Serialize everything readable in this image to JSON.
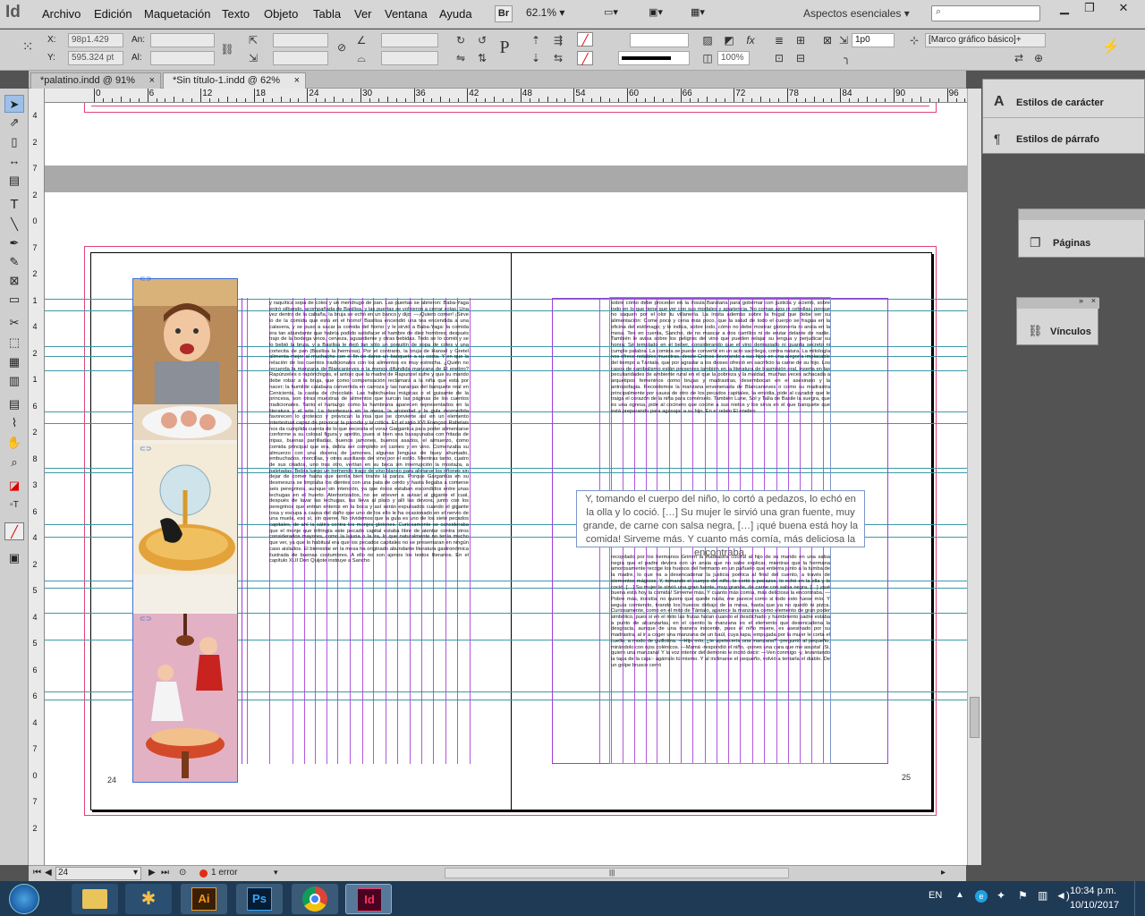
{
  "menubar": {
    "logo": "Id",
    "items": [
      "Archivo",
      "Edición",
      "Maquetación",
      "Texto",
      "Objeto",
      "Tabla",
      "Ver",
      "Ventana",
      "Ayuda"
    ],
    "bridge_label": "Br",
    "zoom": "62.1%",
    "workspace": "Aspectos esenciales",
    "search_placeholder": ""
  },
  "control": {
    "x_label": "X:",
    "x_value": "98p1.429",
    "y_label": "Y:",
    "y_value": "595.324 pt",
    "w_label": "An:",
    "h_label": "Al:",
    "stroke_weight": "1p0",
    "scale_percent": "100%",
    "object_style": "[Marco gráfico básico]+"
  },
  "tabs": [
    {
      "label": "*palatino.indd @ 91%"
    },
    {
      "label": "*Sin título-1.indd @ 62%"
    }
  ],
  "ruler": {
    "h_labels": [
      "0",
      "6",
      "12",
      "18",
      "24",
      "30",
      "36",
      "42",
      "48",
      "54",
      "60",
      "66",
      "72",
      "78",
      "84",
      "90",
      "96"
    ],
    "v_labels": [
      "4",
      "2",
      "7",
      "2",
      "0",
      "7",
      "2",
      "1",
      "4",
      "2",
      "1",
      "6",
      "2",
      "8",
      "3",
      "6",
      "4",
      "2",
      "5",
      "4",
      "5",
      "6",
      "6",
      "4",
      "7",
      "0",
      "7",
      "2"
    ]
  },
  "pages": {
    "left_number": "24",
    "right_number": "25",
    "pull_quote": "Y, tomando el cuerpo del niño, lo cortó a pedazos, lo echó en la olla y lo coció. […] Su mujer le sirvió una gran fuente, muy grande, de carne con salsa negra, […] ¡qué buena está hoy la comida! Sirveme más. Y cuanto más comía, más deliciosa la encontraba.",
    "left_text": "y raquítica sopa de coles y un mendrugo de pan. Las puertas se abrieron: Baba-Yaga entró silbando, acompañada de Basilisa, y las puertas se volvieron a cerrar solas. Una vez dentro de la cabaña, la bruja se echó en un banco y dijo: —¡Quiero comer! ¡Sirve lo de la comida que está en el horno! Basilisa encendió una tea encendida a una calavera, y se puso a sacar la comida del horno: y le sirvió a Baba-Yaga: la comida era tan abundante que habría podido satisfacer el hambre de diez hombres; después trajo de la bodega vinos, cerveza, aguardiente y otras bebidas. Todo se lo comió y se lo bebió la bruja, y a Basilisa le dejó tan sólo un poquitín de sopa de coles y una cortecita de pan (Basilisa la hermosa). Por el contrario, la bruja de Hansel y Gretel alimenta mejor al muchacho con el fin de darse un banquete a su costa. Y en que la relación de los cuentos tradicionales con los alimentos es muy estrecha. ¿Quién no recuerda la manzana de Blancanieves o la menos difundida manzana de El enebro? Rapúnzeles o rapónchigos, el antojo que la madre de Rapunzel sufre y que su marido debe robar a la bruja, que como compensación reclamará a la niña que está por nacer; la humilde calabaza convertida en carroza y las naranjas del banquete real en Cenicienta, la casita de chocolate. Las habichuelas mágicas o el guisante de la princesa, son otras muestras de alimentos que surcan las páginas de los cuentos tradicionales. Tanto el hartazgo como la hambruna aparecen representados en la literatura y el arte. La desmesura en la mesa, la ansiedad y la gula desmedida favorecen lo grotesco y provocan la risa que se convierte así en un elemento intertextual capaz de provocar la parodia y la crítica. En el siglo XVI François Rabelais nos da cumplida cuenta de lo que necesita el voraz Gargantúa para poder alimentarse conforme a su colosal figura y apetito, pues si bien sea basayunaba con fritada de tripas, buenas parrilladas, buenos jamones, buenos asados, el almuerzo, como comida principal que era, debía ser completo en carnes y en vino. Comenzaba su almuerzo con una docena de jamones, algunas lenguas de buey ahumado, embuchados, morcillas, y otros auxiliares del vino por el estilo. Mientras tanto, cuatro de sus criados, uno tras otro, vertían en su boca sin interrupción la mostaza, a paletadas. Bebía luego un tremendo trago de vino blanco para aliviarse los riñones sin dejar de comer hasta que sentía bien tirante la panza. Porque Gargantúa en su desmesura se limpiaba los dientes con una pata de cerdo y hasta llegaba a comerse seis peregrinos, aunque sin intención, ya que éstos estaban escondidos entre unas lechugas en el huerto. Atemorizados, no se atreven a avisar al gigante el cual, después de lavar las lechugas, las lleva al plato y allí las devora, junto con los peregrinos que entran enteros en la boca y así serán expulsados cuando el gigante tosa y escupa a causa del daño que uno de los ello le ha ocasionado en el nervio de una muela, eso sí, sin querer. No olvidemos que la gula es uno de los siete pecados capitales, de ahí la sátira contra los monjes glotones. Curiosamente se consideraba que el monje que infringía este pecado capital estaba libre de atentar contra otros considerados mayores, como la lujuria o la ira, lo que naturalmente no tenía mucho que ver, ya que lo habitual era que los pecados capitales no se presentaran en ningún caso aislados. El bienestar en la mesa ha originado abundante literatura gastronómica ilustrada de buenas costumbres. A ello no son ajenos los textos literarios. En el capítulo XLII Don Quijote instruye a Sancho",
    "right_text_top": "sobre cómo debe proceder en la ínsula Barataria para gobernar con justicia y acierto, sobre todo en lo que tiene que ver con sus modales y apariencia. No comas ajos ni cebollas, porque no saquen por el olor tu villanería. La ínsita además sobre la frugal que debe ser su alimentación: Come poco y cena más poco, que la salud de todo el cuerpo se fragua en la oficina del estómago; y le indica, sobre todo, cómo no debe mostrar glotonería ni ansia en la mesa. Ten en cuenta, Sancho, de no mascar a dos carrillos ni de erutar delante de nadie. También le avisa sobre los peligros del vino que pueden relajar su lengua y perjudicar su honra: Sé templado en el beber, considerando que el vino demasiado ni guarda secreto ni cumple palabra. La comida se puede convertir en un acto sacrílego, contra natura. La mitología nos ofrece notables muestras, desde Cronos devorando a sus hijos en una alegoría implacable del tiempo a Tántalo, que por agradar a los dioses ofreció en sacrificio la carne de su hijo. Los casos de canibalismo están presentes también en la literatura de trasmisión oral, inserta en las peculiaridades de ambiente rural en el que la pobreza y la maldad, muchas veces achacada a arquetipos femeninos como brujas y madrastras, desembocan en el asesinato y la antropofagia. Recordemos la manzana envenenada de Blancanieves o como su madrastra principalmente por causa de otro de los pecados capitales, la envidia, pide al cazador que le traiga el corazón de la niña para comérselo. También Lune, Sol y Talía de Basile la suegra, que es una ogresa, pide al cocinero que cocine a sus nietos y los sirva en el que banquete que está preparando para agasajar a su hijo. En el relato El enebro",
    "right_text_bottom": "recopilado por los hermanos Grimm la madrastra cocina al hijo de su marido en una salsa negra que el padre devora con un ansia que no sabe explicar, mientras que la hermana amorosamente recoge los huesos del hermano en un pañuelo que entierra junto a la tumba de la madre, lo que va a desencadenar la justicia poética al final del cuento, a través de elementos mágicos. Y, tomando el cuerpo del niño, lo cortó a pedazos, lo echó en la olla y lo coció. […] Su mujer le sirvió una gran fuente, muy grande, de carne con salsa negra, […] ¡qué buena está hoy la comida! Sirveme más. Y cuanto más comía, más deliciosa la encontraba. —Pobre más, insistía: no quiero que quede nada; me parece como si todo esto fuese mío. Y seguía comiendo, tirando los huesos debajo de la mesa, hasta que ya no quedó ni pizca. Curiosamente, como en el mito de Tántalo, aparece la manzana como elemento de gran poder simbólico, pues si en el mito las frutas huían cuando el desdichado y hambriento padre estaba a punto de alcanzarlas, en el cuento la manzana es el elemento que desencadena la desgracia, aunque de una manera inocente, pues el niño muere, es asesinado por su madrastra, al ir a coger una manzana de un baúl, cuya tapa, empujada por la mujer le corta el cuello, a modo de guillotina. —Hijo mío, ¿te apetecería una manzana? -preguntó al pequeño, mirándolo con ojos colénicos. —Mamá -respondió el niño, -pones una cara que me asusta! ¡Si, quiero una manzana! Y la voz interior del demonio le incitó decir: —Ven conmigo -y, levantando la tapa de la caja:- agárralo tú mismo. Y al inclinarse el pequeño, volvió a tentarla el diablo. De un golpe brusco cerró"
  },
  "dock": {
    "char_styles": "Estilos de carácter",
    "para_styles": "Estilos de párrafo",
    "pages": "Páginas",
    "links": "Vínculos"
  },
  "status": {
    "page": "24",
    "errors": "1 error"
  },
  "taskbar": {
    "lang": "EN",
    "time": "10:34 p.m.",
    "date": "10/10/2017"
  },
  "colors": {
    "guide": "#3a9aa8",
    "column": "#a23cd6",
    "bleed": "#e0447b",
    "frame": "#3c6fd8"
  }
}
